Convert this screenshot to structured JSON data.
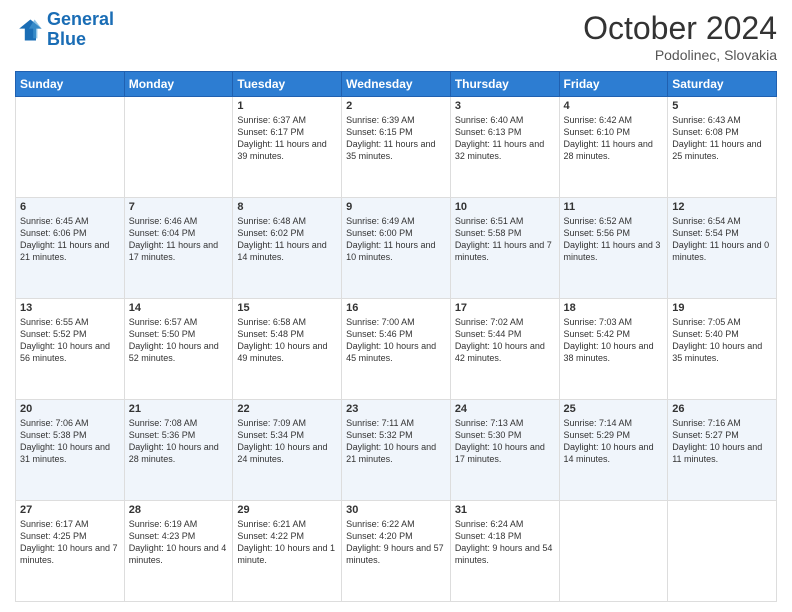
{
  "header": {
    "logo_line1": "General",
    "logo_line2": "Blue",
    "month_title": "October 2024",
    "location": "Podolinec, Slovakia"
  },
  "days_of_week": [
    "Sunday",
    "Monday",
    "Tuesday",
    "Wednesday",
    "Thursday",
    "Friday",
    "Saturday"
  ],
  "weeks": [
    [
      {
        "day": "",
        "content": ""
      },
      {
        "day": "",
        "content": ""
      },
      {
        "day": "1",
        "content": "Sunrise: 6:37 AM\nSunset: 6:17 PM\nDaylight: 11 hours and 39 minutes."
      },
      {
        "day": "2",
        "content": "Sunrise: 6:39 AM\nSunset: 6:15 PM\nDaylight: 11 hours and 35 minutes."
      },
      {
        "day": "3",
        "content": "Sunrise: 6:40 AM\nSunset: 6:13 PM\nDaylight: 11 hours and 32 minutes."
      },
      {
        "day": "4",
        "content": "Sunrise: 6:42 AM\nSunset: 6:10 PM\nDaylight: 11 hours and 28 minutes."
      },
      {
        "day": "5",
        "content": "Sunrise: 6:43 AM\nSunset: 6:08 PM\nDaylight: 11 hours and 25 minutes."
      }
    ],
    [
      {
        "day": "6",
        "content": "Sunrise: 6:45 AM\nSunset: 6:06 PM\nDaylight: 11 hours and 21 minutes."
      },
      {
        "day": "7",
        "content": "Sunrise: 6:46 AM\nSunset: 6:04 PM\nDaylight: 11 hours and 17 minutes."
      },
      {
        "day": "8",
        "content": "Sunrise: 6:48 AM\nSunset: 6:02 PM\nDaylight: 11 hours and 14 minutes."
      },
      {
        "day": "9",
        "content": "Sunrise: 6:49 AM\nSunset: 6:00 PM\nDaylight: 11 hours and 10 minutes."
      },
      {
        "day": "10",
        "content": "Sunrise: 6:51 AM\nSunset: 5:58 PM\nDaylight: 11 hours and 7 minutes."
      },
      {
        "day": "11",
        "content": "Sunrise: 6:52 AM\nSunset: 5:56 PM\nDaylight: 11 hours and 3 minutes."
      },
      {
        "day": "12",
        "content": "Sunrise: 6:54 AM\nSunset: 5:54 PM\nDaylight: 11 hours and 0 minutes."
      }
    ],
    [
      {
        "day": "13",
        "content": "Sunrise: 6:55 AM\nSunset: 5:52 PM\nDaylight: 10 hours and 56 minutes."
      },
      {
        "day": "14",
        "content": "Sunrise: 6:57 AM\nSunset: 5:50 PM\nDaylight: 10 hours and 52 minutes."
      },
      {
        "day": "15",
        "content": "Sunrise: 6:58 AM\nSunset: 5:48 PM\nDaylight: 10 hours and 49 minutes."
      },
      {
        "day": "16",
        "content": "Sunrise: 7:00 AM\nSunset: 5:46 PM\nDaylight: 10 hours and 45 minutes."
      },
      {
        "day": "17",
        "content": "Sunrise: 7:02 AM\nSunset: 5:44 PM\nDaylight: 10 hours and 42 minutes."
      },
      {
        "day": "18",
        "content": "Sunrise: 7:03 AM\nSunset: 5:42 PM\nDaylight: 10 hours and 38 minutes."
      },
      {
        "day": "19",
        "content": "Sunrise: 7:05 AM\nSunset: 5:40 PM\nDaylight: 10 hours and 35 minutes."
      }
    ],
    [
      {
        "day": "20",
        "content": "Sunrise: 7:06 AM\nSunset: 5:38 PM\nDaylight: 10 hours and 31 minutes."
      },
      {
        "day": "21",
        "content": "Sunrise: 7:08 AM\nSunset: 5:36 PM\nDaylight: 10 hours and 28 minutes."
      },
      {
        "day": "22",
        "content": "Sunrise: 7:09 AM\nSunset: 5:34 PM\nDaylight: 10 hours and 24 minutes."
      },
      {
        "day": "23",
        "content": "Sunrise: 7:11 AM\nSunset: 5:32 PM\nDaylight: 10 hours and 21 minutes."
      },
      {
        "day": "24",
        "content": "Sunrise: 7:13 AM\nSunset: 5:30 PM\nDaylight: 10 hours and 17 minutes."
      },
      {
        "day": "25",
        "content": "Sunrise: 7:14 AM\nSunset: 5:29 PM\nDaylight: 10 hours and 14 minutes."
      },
      {
        "day": "26",
        "content": "Sunrise: 7:16 AM\nSunset: 5:27 PM\nDaylight: 10 hours and 11 minutes."
      }
    ],
    [
      {
        "day": "27",
        "content": "Sunrise: 6:17 AM\nSunset: 4:25 PM\nDaylight: 10 hours and 7 minutes."
      },
      {
        "day": "28",
        "content": "Sunrise: 6:19 AM\nSunset: 4:23 PM\nDaylight: 10 hours and 4 minutes."
      },
      {
        "day": "29",
        "content": "Sunrise: 6:21 AM\nSunset: 4:22 PM\nDaylight: 10 hours and 1 minute."
      },
      {
        "day": "30",
        "content": "Sunrise: 6:22 AM\nSunset: 4:20 PM\nDaylight: 9 hours and 57 minutes."
      },
      {
        "day": "31",
        "content": "Sunrise: 6:24 AM\nSunset: 4:18 PM\nDaylight: 9 hours and 54 minutes."
      },
      {
        "day": "",
        "content": ""
      },
      {
        "day": "",
        "content": ""
      }
    ]
  ]
}
